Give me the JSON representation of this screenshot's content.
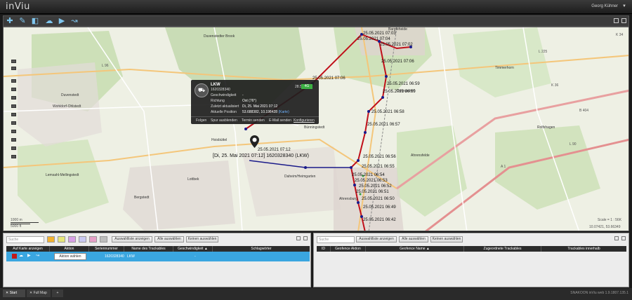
{
  "app": {
    "logo": "inViu",
    "user": "Georg Kühner"
  },
  "colors": {
    "accent": "#3aa6e0",
    "route": "#c0101a",
    "route_dots": "#1a1a8a",
    "signal": "#3cb043"
  },
  "toolbar": {
    "icons": [
      "plus-icon",
      "pencil-icon",
      "shape-icon",
      "layers-icon",
      "play-icon",
      "route-icon"
    ]
  },
  "map": {
    "places": [
      "Duvenstedter Brook",
      "Duvenstedt",
      "Wohldorf-Ohlstedt",
      "Lemsahl-Mellingstedt",
      "Bergstedt",
      "Hoisbüttel",
      "Lottbek",
      "Bünningstedt",
      "Daheim/Heimgarten",
      "Ahrensburg",
      "Bargteheide",
      "Delingsdorf",
      "Timmerhorn",
      "Rolfshagen",
      "Ahrensfelde"
    ],
    "road_labels": [
      "L 96",
      "K 34",
      "L 225",
      "K 36",
      "B 404",
      "A 1",
      "L 90"
    ],
    "scale": {
      "m": "1000 m",
      "ft": "5000 ft"
    },
    "attribution": "Scale = 1 : 56K",
    "coords": "10.07421, 53.66349",
    "track_labels": [
      "25.05.2021 07:03",
      "25.05.2021 07:04",
      "25.05.2021 07:02",
      "25.05.2021 07:06",
      "25.05.2021 07:06",
      "25.05.2021 06:59",
      "25.05.2021 06:59",
      "25.05.2021 06:58",
      "25.05.2021 06:57",
      "25.05.2021 06:56",
      "25.05.2021 06:55",
      "25.05.2021 06:54",
      "25.05.2021 06:53",
      "25.05.2021 06:52",
      "25.05.2021 06:51",
      "25.05.2021 06:50",
      "25.05.2021 06:49",
      "25.05.2021 06:42",
      "25.05.2021 07:12"
    ],
    "marker_caption": "[Di, 25. Mai 2021 07:12] 1620328340 (LKW)"
  },
  "popup": {
    "name": "LKW",
    "serial": "1620328340",
    "battery": "28.5",
    "signal": "4G",
    "rows": [
      {
        "label": "Geschwindigkeit",
        "value": "-"
      },
      {
        "label": "Richtung",
        "value": "Ost (76°)"
      },
      {
        "label": "Zuletzt aktualisiert",
        "value": "Di, 25. Mai 2021 07:12"
      },
      {
        "label": "Aktuelle Position",
        "value": "53.688382, 10.198428",
        "link": "(Karte)"
      }
    ],
    "actions": [
      "Folgen",
      "Spur ausblenden",
      "Termin senden",
      "E-Mail senden",
      "Konfigurieren"
    ]
  },
  "left_panel": {
    "search_placeholder": "Suche",
    "buttons": [
      "Auswahlliste anzeigen",
      "Alle auswählen",
      "Keinen auswählen"
    ],
    "swatch_colors": [
      "#f2b230",
      "#e6e67a",
      "#d7a0e6",
      "#c9c9f2",
      "#e6a0c8",
      "#bdbdbd"
    ],
    "columns": [
      "Auf Karte anzeigen",
      "Aktion",
      "Seriennummer",
      "Name des Trackables",
      "Geschwindigkeit ▲",
      "Schlagwörter"
    ],
    "row": {
      "action": "Aktion wählen",
      "serial": "1620328340",
      "name": "LKW",
      "speed": "-",
      "tags": ""
    }
  },
  "right_panel": {
    "search_placeholder": "Suche",
    "buttons": [
      "Auswahlliste anzeigen",
      "Alle auswählen",
      "Keinen auswählen"
    ],
    "columns": [
      "ID",
      "Geofence Aktion",
      "Geofence Name ▲",
      "Zugeordnete Trackables",
      "Trackables innerhalb"
    ]
  },
  "footer": {
    "tabs": [
      "Start",
      "Full Map",
      "+"
    ],
    "version": "SNAKOON inViu web 1.9.1807.135.1"
  }
}
